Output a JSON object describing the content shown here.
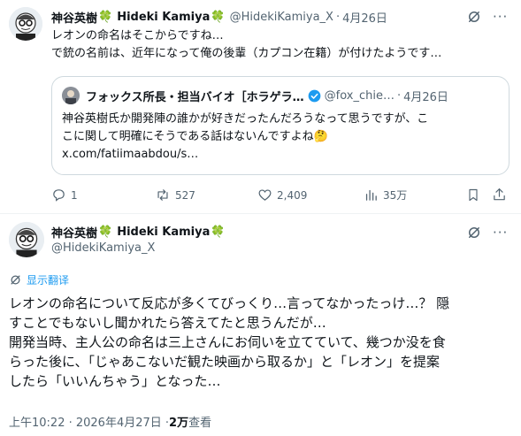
{
  "reply": {
    "author_name": "神谷英樹",
    "author_clover_1": "🍀",
    "author_latin": "Hideki Kamiya",
    "author_clover_2": "🍀",
    "handle": "@HidekiKamiya_X",
    "dot": "·",
    "date": "4月26日",
    "text_line1": "レオンの命名はそこからですね…",
    "text_line2": "で銃の名前は、近年になって俺の後輩（カプコン在籍）が付けたようです…",
    "quote": {
      "author": "フォックス所長・担当バイオ［ホラゲラ…",
      "handle": "@fox_chie…",
      "dot": "·",
      "date": "4月26日",
      "line1": "神谷英樹氏か開発陣の誰かが好きだったんだろうなって思うですが、こ",
      "line2": "こに関して明確にそうである話はないんですよね🤔",
      "line3": "x.com/fatiimaabdou/s…"
    },
    "actions": {
      "replies": "1",
      "reposts": "527",
      "likes": "2,409",
      "views": "35万"
    }
  },
  "main": {
    "author_name": "神谷英樹",
    "author_clover_1": "🍀",
    "author_latin": "Hideki Kamiya",
    "author_clover_2": "🍀",
    "handle": "@HidekiKamiya_X",
    "translate_label": "显示翻译",
    "text": [
      "レオンの命名について反応が多くてびっくり…言ってなかったっけ…？ 隠",
      "すことでもないし聞かれたら答えてたと思うんだが…",
      "開発当時、主人公の命名は三上さんにお伺いを立てていて、幾つか没を食",
      "らった後に、「じゃあこないだ観た映画から取るか」と「レオン」を提案",
      "したら「いいんちゃう」となった…"
    ],
    "timestamp": "上午10:22 · 2026年4月27日 · ",
    "views_count": "2万",
    "views_label": " 查看"
  },
  "colors": {
    "accent": "#1d9bf0",
    "grey": "#536471",
    "border": "#cfd9de",
    "clover": "#2ea043"
  }
}
